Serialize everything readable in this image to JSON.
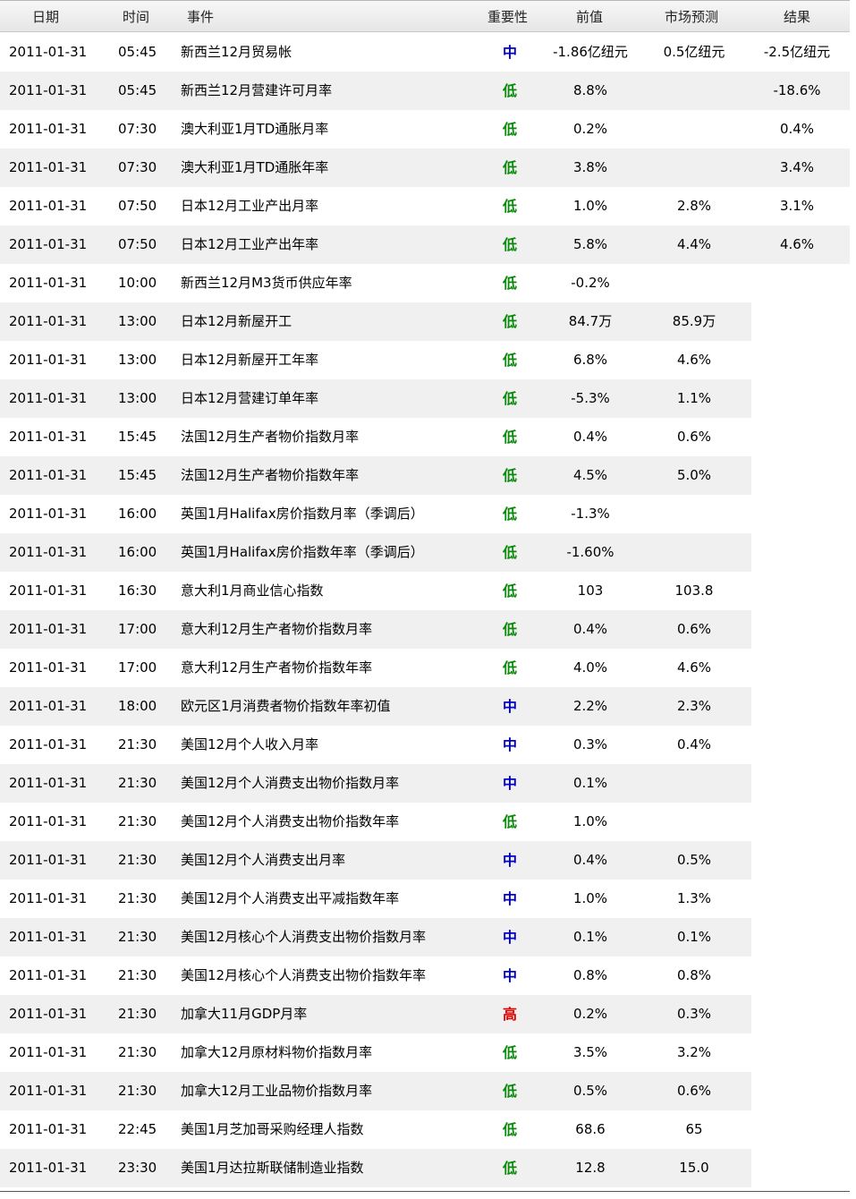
{
  "columns": {
    "date": "日期",
    "time": "时间",
    "event": "事件",
    "importance": "重要性",
    "previous": "前值",
    "forecast": "市场预测",
    "result": "结果"
  },
  "colors": {
    "低": "#0a8a0a",
    "中": "#0000cc",
    "高": "#e00000"
  },
  "rows": [
    {
      "date": "2011-01-31",
      "time": "05:45",
      "event": "新西兰12月贸易帐",
      "importance": "中",
      "previous": "-1.86亿纽元",
      "forecast": "0.5亿纽元",
      "result": "-2.5亿纽元"
    },
    {
      "date": "2011-01-31",
      "time": "05:45",
      "event": "新西兰12月营建许可月率",
      "importance": "低",
      "previous": "8.8%",
      "forecast": "",
      "result": "-18.6%"
    },
    {
      "date": "2011-01-31",
      "time": "07:30",
      "event": "澳大利亚1月TD通胀月率",
      "importance": "低",
      "previous": "0.2%",
      "forecast": "",
      "result": "0.4%"
    },
    {
      "date": "2011-01-31",
      "time": "07:30",
      "event": "澳大利亚1月TD通胀年率",
      "importance": "低",
      "previous": "3.8%",
      "forecast": "",
      "result": "3.4%"
    },
    {
      "date": "2011-01-31",
      "time": "07:50",
      "event": "日本12月工业产出月率",
      "importance": "低",
      "previous": "1.0%",
      "forecast": "2.8%",
      "result": "3.1%"
    },
    {
      "date": "2011-01-31",
      "time": "07:50",
      "event": "日本12月工业产出年率",
      "importance": "低",
      "previous": "5.8%",
      "forecast": "4.4%",
      "result": "4.6%"
    },
    {
      "date": "2011-01-31",
      "time": "10:00",
      "event": "新西兰12月M3货币供应年率",
      "importance": "低",
      "previous": "-0.2%",
      "forecast": "",
      "result": ""
    },
    {
      "date": "2011-01-31",
      "time": "13:00",
      "event": "日本12月新屋开工",
      "importance": "低",
      "previous": "84.7万",
      "forecast": "85.9万",
      "result": ""
    },
    {
      "date": "2011-01-31",
      "time": "13:00",
      "event": "日本12月新屋开工年率",
      "importance": "低",
      "previous": "6.8%",
      "forecast": "4.6%",
      "result": ""
    },
    {
      "date": "2011-01-31",
      "time": "13:00",
      "event": "日本12月营建订单年率",
      "importance": "低",
      "previous": "-5.3%",
      "forecast": "1.1%",
      "result": ""
    },
    {
      "date": "2011-01-31",
      "time": "15:45",
      "event": "法国12月生产者物价指数月率",
      "importance": "低",
      "previous": "0.4%",
      "forecast": "0.6%",
      "result": ""
    },
    {
      "date": "2011-01-31",
      "time": "15:45",
      "event": "法国12月生产者物价指数年率",
      "importance": "低",
      "previous": "4.5%",
      "forecast": "5.0%",
      "result": ""
    },
    {
      "date": "2011-01-31",
      "time": "16:00",
      "event": "英国1月Halifax房价指数月率（季调后）",
      "importance": "低",
      "previous": "-1.3%",
      "forecast": "",
      "result": ""
    },
    {
      "date": "2011-01-31",
      "time": "16:00",
      "event": "英国1月Halifax房价指数年率（季调后）",
      "importance": "低",
      "previous": "-1.60%",
      "forecast": "",
      "result": ""
    },
    {
      "date": "2011-01-31",
      "time": "16:30",
      "event": "意大利1月商业信心指数",
      "importance": "低",
      "previous": "103",
      "forecast": "103.8",
      "result": ""
    },
    {
      "date": "2011-01-31",
      "time": "17:00",
      "event": "意大利12月生产者物价指数月率",
      "importance": "低",
      "previous": "0.4%",
      "forecast": "0.6%",
      "result": ""
    },
    {
      "date": "2011-01-31",
      "time": "17:00",
      "event": "意大利12月生产者物价指数年率",
      "importance": "低",
      "previous": "4.0%",
      "forecast": "4.6%",
      "result": ""
    },
    {
      "date": "2011-01-31",
      "time": "18:00",
      "event": "欧元区1月消费者物价指数年率初值",
      "importance": "中",
      "previous": "2.2%",
      "forecast": "2.3%",
      "result": ""
    },
    {
      "date": "2011-01-31",
      "time": "21:30",
      "event": "美国12月个人收入月率",
      "importance": "中",
      "previous": "0.3%",
      "forecast": "0.4%",
      "result": ""
    },
    {
      "date": "2011-01-31",
      "time": "21:30",
      "event": "美国12月个人消费支出物价指数月率",
      "importance": "中",
      "previous": "0.1%",
      "forecast": "",
      "result": ""
    },
    {
      "date": "2011-01-31",
      "time": "21:30",
      "event": "美国12月个人消费支出物价指数年率",
      "importance": "低",
      "previous": "1.0%",
      "forecast": "",
      "result": ""
    },
    {
      "date": "2011-01-31",
      "time": "21:30",
      "event": "美国12月个人消费支出月率",
      "importance": "中",
      "previous": "0.4%",
      "forecast": "0.5%",
      "result": ""
    },
    {
      "date": "2011-01-31",
      "time": "21:30",
      "event": "美国12月个人消费支出平减指数年率",
      "importance": "中",
      "previous": "1.0%",
      "forecast": "1.3%",
      "result": ""
    },
    {
      "date": "2011-01-31",
      "time": "21:30",
      "event": "美国12月核心个人消费支出物价指数月率",
      "importance": "中",
      "previous": "0.1%",
      "forecast": "0.1%",
      "result": ""
    },
    {
      "date": "2011-01-31",
      "time": "21:30",
      "event": "美国12月核心个人消费支出物价指数年率",
      "importance": "中",
      "previous": "0.8%",
      "forecast": "0.8%",
      "result": ""
    },
    {
      "date": "2011-01-31",
      "time": "21:30",
      "event": "加拿大11月GDP月率",
      "importance": "高",
      "previous": "0.2%",
      "forecast": "0.3%",
      "result": ""
    },
    {
      "date": "2011-01-31",
      "time": "21:30",
      "event": "加拿大12月原材料物价指数月率",
      "importance": "低",
      "previous": "3.5%",
      "forecast": "3.2%",
      "result": ""
    },
    {
      "date": "2011-01-31",
      "time": "21:30",
      "event": "加拿大12月工业品物价指数月率",
      "importance": "低",
      "previous": "0.5%",
      "forecast": "0.6%",
      "result": ""
    },
    {
      "date": "2011-01-31",
      "time": "22:45",
      "event": "美国1月芝加哥采购经理人指数",
      "importance": "低",
      "previous": "68.6",
      "forecast": "65",
      "result": ""
    },
    {
      "date": "2011-01-31",
      "time": "23:30",
      "event": "美国1月达拉斯联储制造业指数",
      "importance": "低",
      "previous": "12.8",
      "forecast": "15.0",
      "result": ""
    }
  ]
}
